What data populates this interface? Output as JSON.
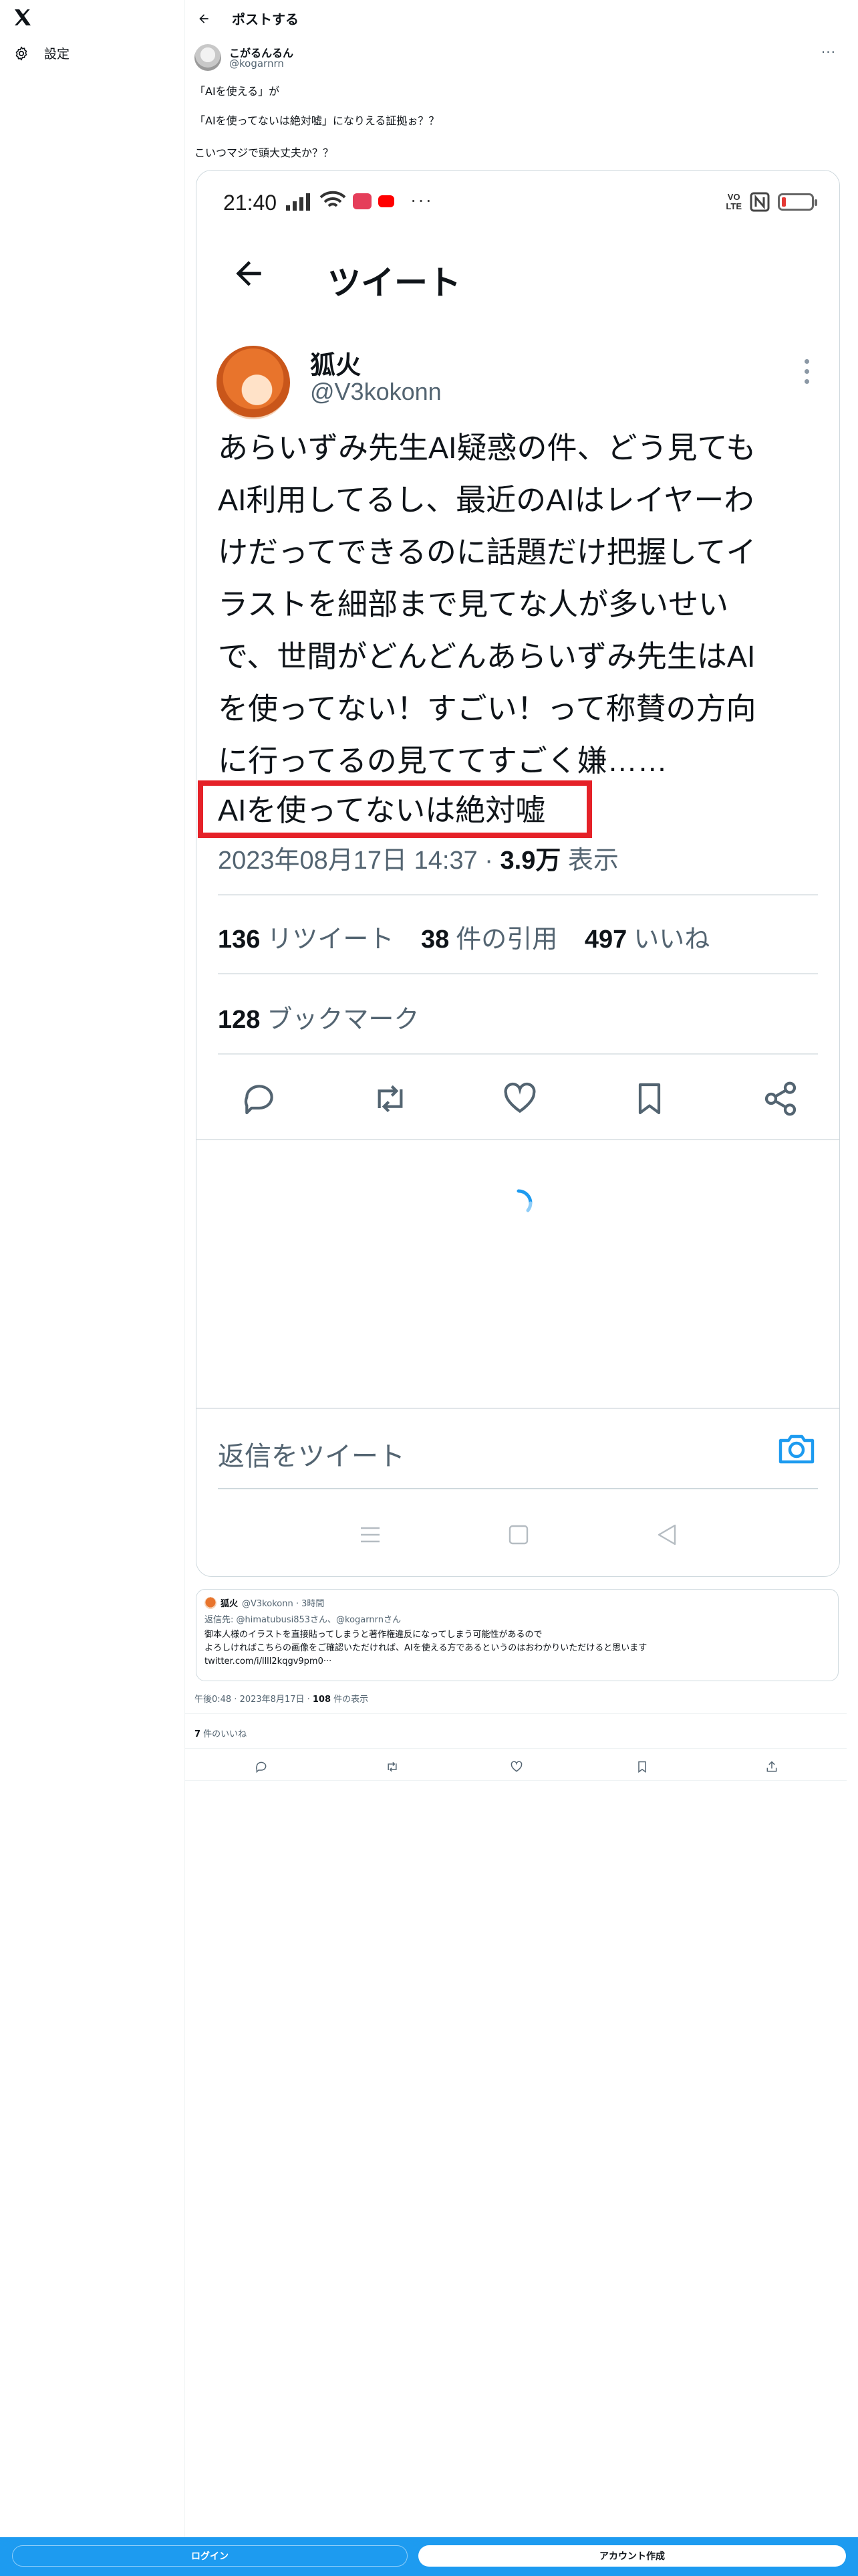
{
  "rail": {
    "settings_label": "設定"
  },
  "header": {
    "title": "ポストする"
  },
  "post": {
    "author_name": "こがるんるん",
    "author_handle": "@kogarnrn",
    "more": "···",
    "lines": [
      "「AIを使える」が",
      "「AIを使ってないは絶対嘘」になりえる証拠ぉ？？",
      "こいつマジで頭大丈夫か？？"
    ]
  },
  "screenshot": {
    "clock": "21:40",
    "status_dots": "···",
    "volte": [
      "VO",
      "LTE"
    ],
    "header_title": "ツイート",
    "author_name": "狐火",
    "author_handle": "@V3kokonn",
    "body_lines": [
      "あらいずみ先生AI疑惑の件、どう見ても",
      "AI利用してるし、最近のAIはレイヤーわ",
      "けだってできるのに話題だけ把握してイ",
      "ラストを細部まで見てな人が多いせい",
      "で、世間がどんどんあらいずみ先生はAI",
      "を使ってない！すごい！って称賛の方向",
      "に行ってるの見ててすごく嫌……"
    ],
    "highlight_line": "AIを使ってないは絶対嘘",
    "timestamp": "2023年08月17日 14:37 · ",
    "views_count": "3.9万",
    "views_label": " 表示",
    "retweets_count": "136",
    "retweets_label": "リツイート",
    "quotes_count": "38",
    "quotes_label": "件の引用",
    "likes_count": "497",
    "likes_label": "いいね",
    "bookmarks_count": "128",
    "bookmarks_label": "ブックマーク",
    "reply_placeholder": "返信をツイート"
  },
  "quote": {
    "name": "狐火",
    "handle_time": "@V3kokonn · 3時間",
    "reply_to": "返信先: @himatubusi853さん、@kogarnrnさん",
    "line1": "御本人様のイラストを直接貼ってしまうと著作権違反になってしまう可能性があるので",
    "line2": "よろしければこちらの画像をご確認いただければ、AIを使える方であるというのはおわかりいただけると思います",
    "link": "twitter.com/i/llll2kqgv9pm0···"
  },
  "meta": {
    "time": "午後0:48 · 2023年8月17日 · ",
    "views_count": "108",
    "views_label": " 件の表示",
    "likes_count": "7",
    "likes_label": " 件のいいね"
  },
  "login": {
    "login_label": "ログイン",
    "signup_label": "アカウント作成"
  },
  "colors": {
    "accent": "#1d9bf0",
    "highlight_box": "#e52128",
    "muted": "#536471"
  }
}
